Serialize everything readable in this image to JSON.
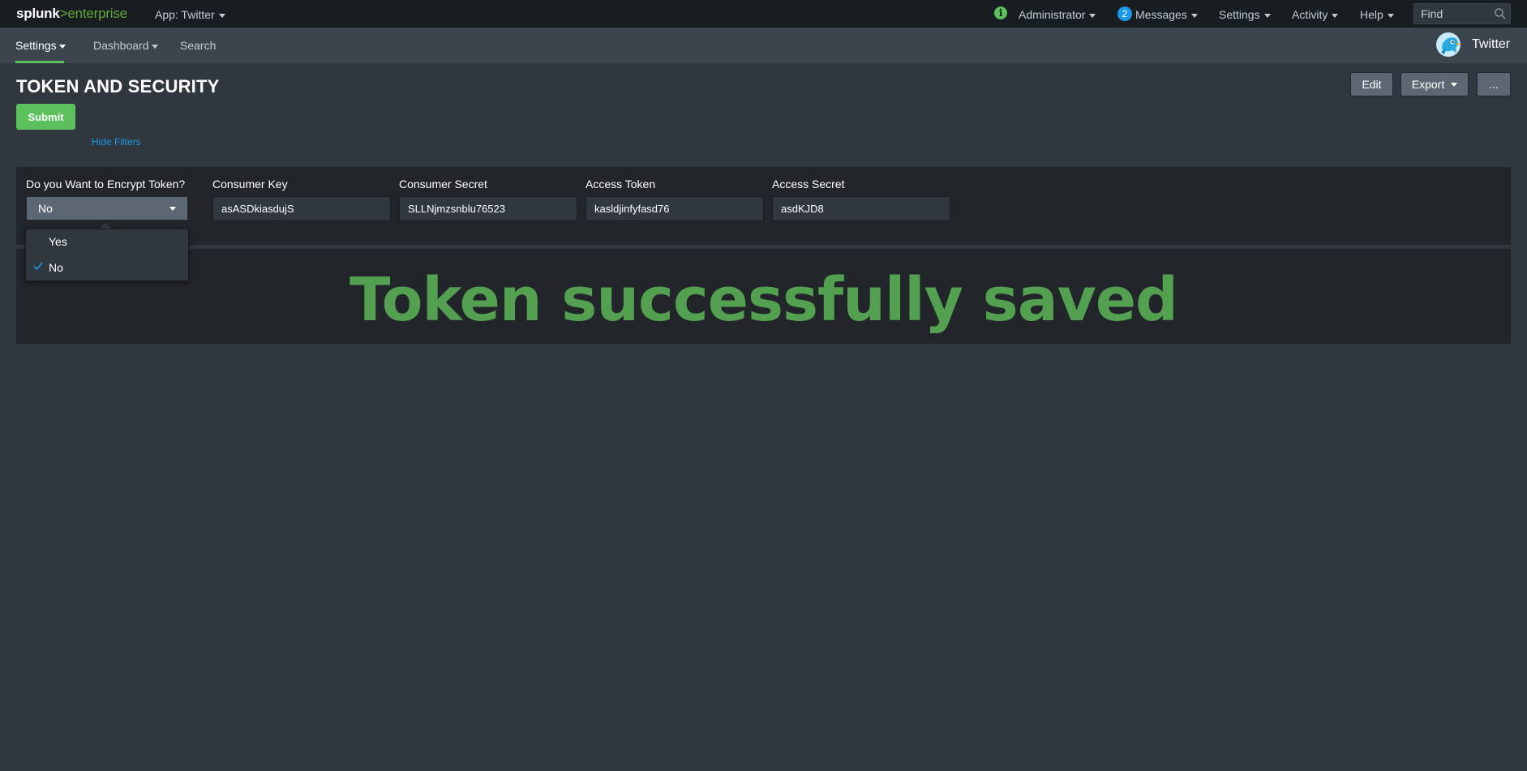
{
  "topbar": {
    "logo_splunk": "splunk",
    "logo_gt": ">",
    "logo_enterprise": "enterprise",
    "app_menu": "App: Twitter",
    "info_icon": "i",
    "admin": "Administrator",
    "messages_count": "2",
    "messages": "Messages",
    "settings": "Settings",
    "activity": "Activity",
    "help": "Help",
    "find_placeholder": "Find"
  },
  "appbar": {
    "settings": "Settings",
    "dashboard": "Dashboard",
    "search": "Search",
    "app_name": "Twitter"
  },
  "dashboard": {
    "title": "TOKEN AND SECURITY",
    "edit": "Edit",
    "export": "Export",
    "more": "...",
    "submit": "Submit",
    "hide_filters": "Hide Filters"
  },
  "filters": {
    "encrypt_label": "Do you Want to Encrypt Token?",
    "encrypt_value": "No",
    "encrypt_options": [
      "Yes",
      "No"
    ],
    "consumer_key_label": "Consumer Key",
    "consumer_key_value": "asASDkiasdujS",
    "consumer_secret_label": "Consumer Secret",
    "consumer_secret_value": "SLLNjmzsnblu76523",
    "access_token_label": "Access Token",
    "access_token_value": "kasldjinfyfasd76",
    "access_secret_label": "Access Secret",
    "access_secret_value": "asdKJD8"
  },
  "result": {
    "message": "Token successfully saved"
  },
  "colors": {
    "accent_green": "#5cc05c",
    "result_green": "#53a051",
    "link_blue": "#1a9ae8"
  }
}
